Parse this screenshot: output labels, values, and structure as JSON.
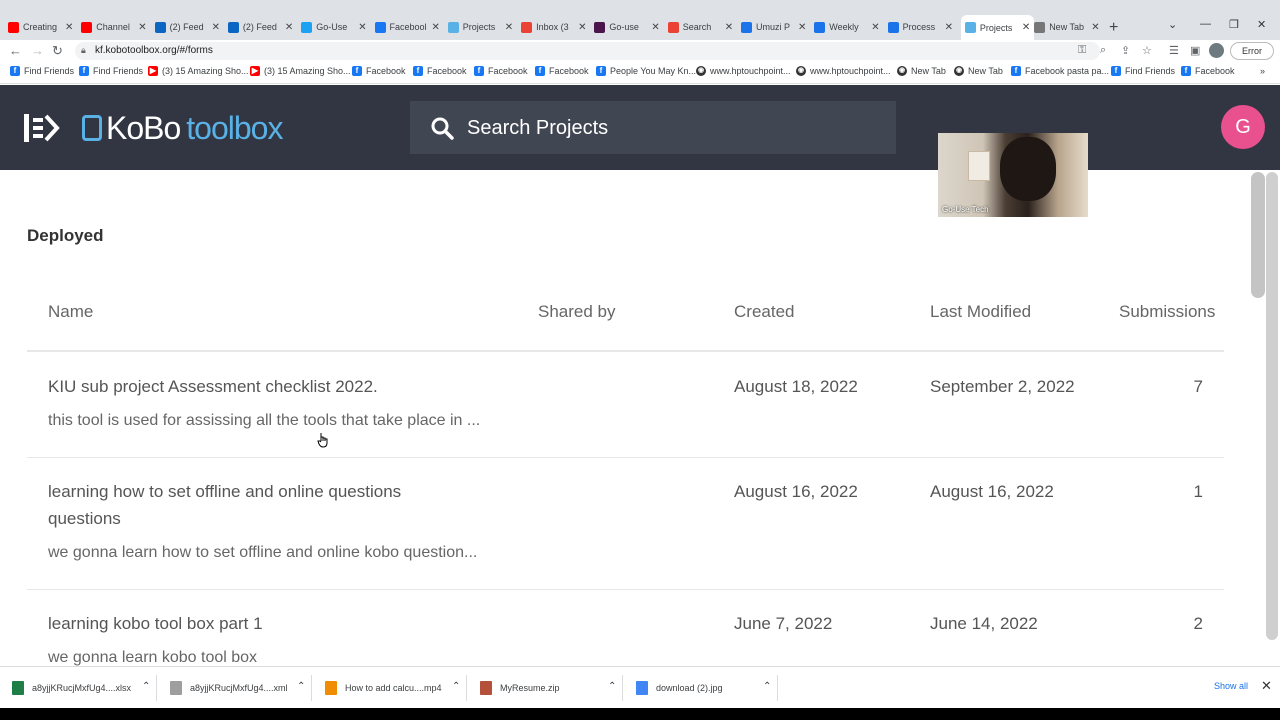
{
  "browser": {
    "tabs": [
      {
        "title": "Creating",
        "color": "#ff0000"
      },
      {
        "title": "Channel",
        "color": "#ff0000"
      },
      {
        "title": "(2) Feed",
        "color": "#0a66c2"
      },
      {
        "title": "(2) Feed",
        "color": "#0a66c2"
      },
      {
        "title": "Go-Use",
        "color": "#1da1f2"
      },
      {
        "title": "Facebook",
        "color": "#1877f2"
      },
      {
        "title": "Projects",
        "color": "#59b1e6"
      },
      {
        "title": "Inbox (3",
        "color": "#ea4335"
      },
      {
        "title": "Go-use",
        "color": "#4a154b"
      },
      {
        "title": "Search",
        "color": "#ea4335"
      },
      {
        "title": "Umuzi P",
        "color": "#1a73e8"
      },
      {
        "title": "Weekly",
        "color": "#1a73e8"
      },
      {
        "title": "Process",
        "color": "#1a73e8"
      },
      {
        "title": "Projects",
        "color": "#59b1e6"
      },
      {
        "title": "New Tab",
        "color": "#777777"
      }
    ],
    "active_tab_index": 13,
    "url": "kf.kobotoolbox.org/#/forms",
    "error_label": "Error",
    "bookmarks": [
      {
        "label": "Find Friends",
        "icon": "facebook-icon"
      },
      {
        "label": "Find Friends",
        "icon": "facebook-icon"
      },
      {
        "label": "(3) 15 Amazing Sho...",
        "icon": "youtube-icon"
      },
      {
        "label": "(3) 15 Amazing Sho...",
        "icon": "youtube-icon"
      },
      {
        "label": "Facebook",
        "icon": "facebook-icon"
      },
      {
        "label": "Facebook",
        "icon": "facebook-icon"
      },
      {
        "label": "Facebook",
        "icon": "facebook-icon"
      },
      {
        "label": "Facebook",
        "icon": "facebook-icon"
      },
      {
        "label": "People You May Kn...",
        "icon": "facebook-icon"
      },
      {
        "label": "www.hptouchpoint...",
        "icon": "globe-icon"
      },
      {
        "label": "www.hptouchpoint...",
        "icon": "globe-icon"
      },
      {
        "label": "New Tab",
        "icon": "globe-icon"
      },
      {
        "label": "New Tab",
        "icon": "globe-icon"
      },
      {
        "label": "Facebook pasta pa...",
        "icon": "facebook-icon"
      },
      {
        "label": "Find Friends",
        "icon": "facebook-icon"
      },
      {
        "label": "Facebook",
        "icon": "facebook-icon"
      }
    ]
  },
  "app": {
    "logo_kobo": "KoBo",
    "logo_toolbox": "toolbox",
    "search_placeholder": "Search Projects",
    "avatar_initial": "G",
    "video_label": "Go-Use Tech"
  },
  "content": {
    "section_title": "Deployed",
    "columns": {
      "name": "Name",
      "shared_by": "Shared by",
      "created": "Created",
      "last_modified": "Last Modified",
      "submissions": "Submissions"
    },
    "projects": [
      {
        "name": "KIU sub project Assessment checklist 2022.",
        "description": "this tool is used for assissing all the tools that take place in ...",
        "shared_by": "",
        "created": "August 18, 2022",
        "last_modified": "September 2, 2022",
        "submissions": "7"
      },
      {
        "name_line1": "learning how to set offline and online questions",
        "name_line2": "questions",
        "description": "we gonna learn how to set offline and online kobo question...",
        "shared_by": "",
        "created": "August 16, 2022",
        "last_modified": "August 16, 2022",
        "submissions": "1"
      },
      {
        "name": "learning kobo tool box part 1",
        "description": "we gonna learn kobo tool box",
        "shared_by": "",
        "created": "June 7, 2022",
        "last_modified": "June 14, 2022",
        "submissions": "2"
      }
    ]
  },
  "downloads": {
    "items": [
      {
        "name": "a8yjjKRucjMxfUg4....xlsx",
        "color": "#1e7e45"
      },
      {
        "name": "a8yjjKRucjMxfUg4....xml",
        "color": "#9e9e9e"
      },
      {
        "name": "How to add calcu....mp4",
        "color": "#f08c00"
      },
      {
        "name": "MyResume.zip",
        "color": "#b5513a"
      },
      {
        "name": "download (2).jpg",
        "color": "#4285f4"
      }
    ],
    "show_all": "Show all"
  }
}
